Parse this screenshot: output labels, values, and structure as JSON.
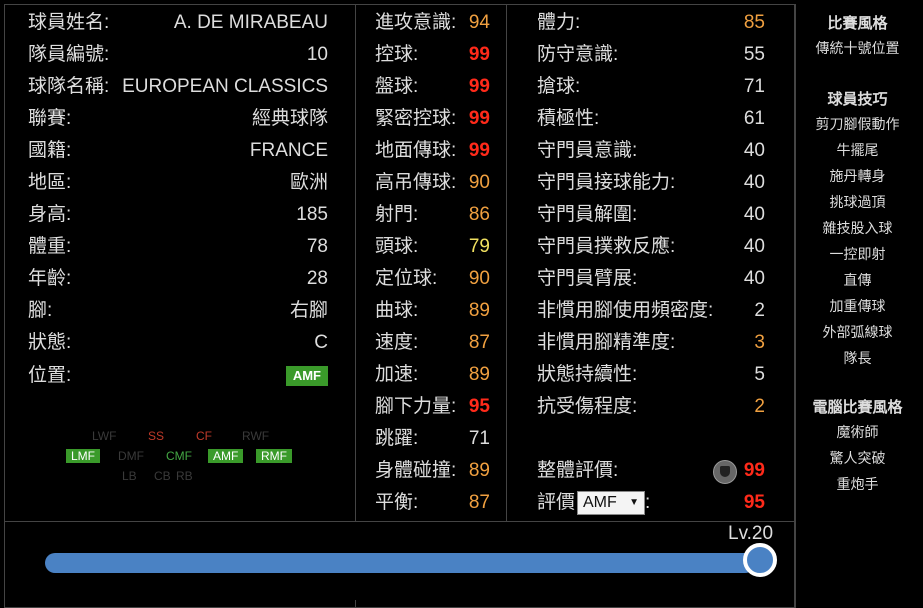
{
  "profile": {
    "rows": [
      {
        "label": "球員姓名:",
        "value": "A. DE MIRABEAU"
      },
      {
        "label": "隊員編號:",
        "value": "10"
      },
      {
        "label": "球隊名稱:",
        "value": "EUROPEAN CLASSICS"
      },
      {
        "label": "聯賽:",
        "value": "經典球隊"
      },
      {
        "label": "國籍:",
        "value": "FRANCE"
      },
      {
        "label": "地區:",
        "value": "歐洲"
      },
      {
        "label": "身高:",
        "value": "185"
      },
      {
        "label": "體重:",
        "value": "78"
      },
      {
        "label": "年齡:",
        "value": "28"
      },
      {
        "label": "腳:",
        "value": "右腳"
      },
      {
        "label": "狀態:",
        "value": "C"
      }
    ],
    "position_label": "位置:",
    "position_value": "AMF"
  },
  "position_map": {
    "lmf": "LMF",
    "dmf": "DMF",
    "cmf": "CMF",
    "amf": "AMF",
    "rmf": "RMF",
    "ss": "SS",
    "cf": "CF",
    "lwf": "LWF",
    "rwf": "RWF",
    "cb": "CB",
    "lb": "LB",
    "rb": "RB"
  },
  "attributes_mid": [
    {
      "label": "進攻意識:",
      "value": "94",
      "tier": "orange"
    },
    {
      "label": "控球:",
      "value": "99",
      "tier": "red"
    },
    {
      "label": "盤球:",
      "value": "99",
      "tier": "red"
    },
    {
      "label": "緊密控球:",
      "value": "99",
      "tier": "red"
    },
    {
      "label": "地面傳球:",
      "value": "99",
      "tier": "red"
    },
    {
      "label": "高吊傳球:",
      "value": "90",
      "tier": "orange"
    },
    {
      "label": "射門:",
      "value": "86",
      "tier": "orange"
    },
    {
      "label": "頭球:",
      "value": "79",
      "tier": "yellow"
    },
    {
      "label": "定位球:",
      "value": "90",
      "tier": "orange"
    },
    {
      "label": "曲球:",
      "value": "89",
      "tier": "orange"
    },
    {
      "label": "速度:",
      "value": "87",
      "tier": "orange"
    },
    {
      "label": "加速:",
      "value": "89",
      "tier": "orange"
    },
    {
      "label": "腳下力量:",
      "value": "95",
      "tier": "red"
    },
    {
      "label": "跳躍:",
      "value": "71",
      "tier": "white"
    },
    {
      "label": "身體碰撞:",
      "value": "89",
      "tier": "orange"
    },
    {
      "label": "平衡:",
      "value": "87",
      "tier": "orange"
    }
  ],
  "attributes_right": [
    {
      "label": "體力:",
      "value": "85",
      "tier": "orange"
    },
    {
      "label": "防守意識:",
      "value": "55",
      "tier": "white"
    },
    {
      "label": "搶球:",
      "value": "71",
      "tier": "white"
    },
    {
      "label": "積極性:",
      "value": "61",
      "tier": "white"
    },
    {
      "label": "守門員意識:",
      "value": "40",
      "tier": "white"
    },
    {
      "label": "守門員接球能力:",
      "value": "40",
      "tier": "white"
    },
    {
      "label": "守門員解圍:",
      "value": "40",
      "tier": "white"
    },
    {
      "label": "守門員撲救反應:",
      "value": "40",
      "tier": "white"
    },
    {
      "label": "守門員臂展:",
      "value": "40",
      "tier": "white"
    },
    {
      "label": "非慣用腳使用頻密度:",
      "value": "2",
      "tier": "white"
    },
    {
      "label": "非慣用腳精準度:",
      "value": "3",
      "tier": "orange"
    },
    {
      "label": "狀態持續性:",
      "value": "5",
      "tier": "white"
    },
    {
      "label": "抗受傷程度:",
      "value": "2",
      "tier": "orange"
    }
  ],
  "overall": {
    "label": "整體評價:",
    "value": "99"
  },
  "rating": {
    "label": "評價",
    "selected": "AMF",
    "value": "95"
  },
  "sidebar": {
    "play_style_title": "比賽風格",
    "play_style": "傳統十號位置",
    "skills_title": "球員技巧",
    "skills": [
      "剪刀腳假動作",
      "牛擺尾",
      "施丹轉身",
      "挑球過頂",
      "雜技股入球",
      "一控即射",
      "直傳",
      "加重傳球",
      "外部弧線球",
      "隊長"
    ],
    "ai_title": "電腦比賽風格",
    "ai": [
      "魔術師",
      "驚人突破",
      "重炮手"
    ]
  },
  "level": {
    "label": "Lv.20",
    "fraction": 1.0
  },
  "colors": {
    "red": "#ff2a1a",
    "orange": "#f0a040",
    "yellow": "#f0e060",
    "green": "#3a9a2a",
    "slider": "#4a82c4"
  }
}
